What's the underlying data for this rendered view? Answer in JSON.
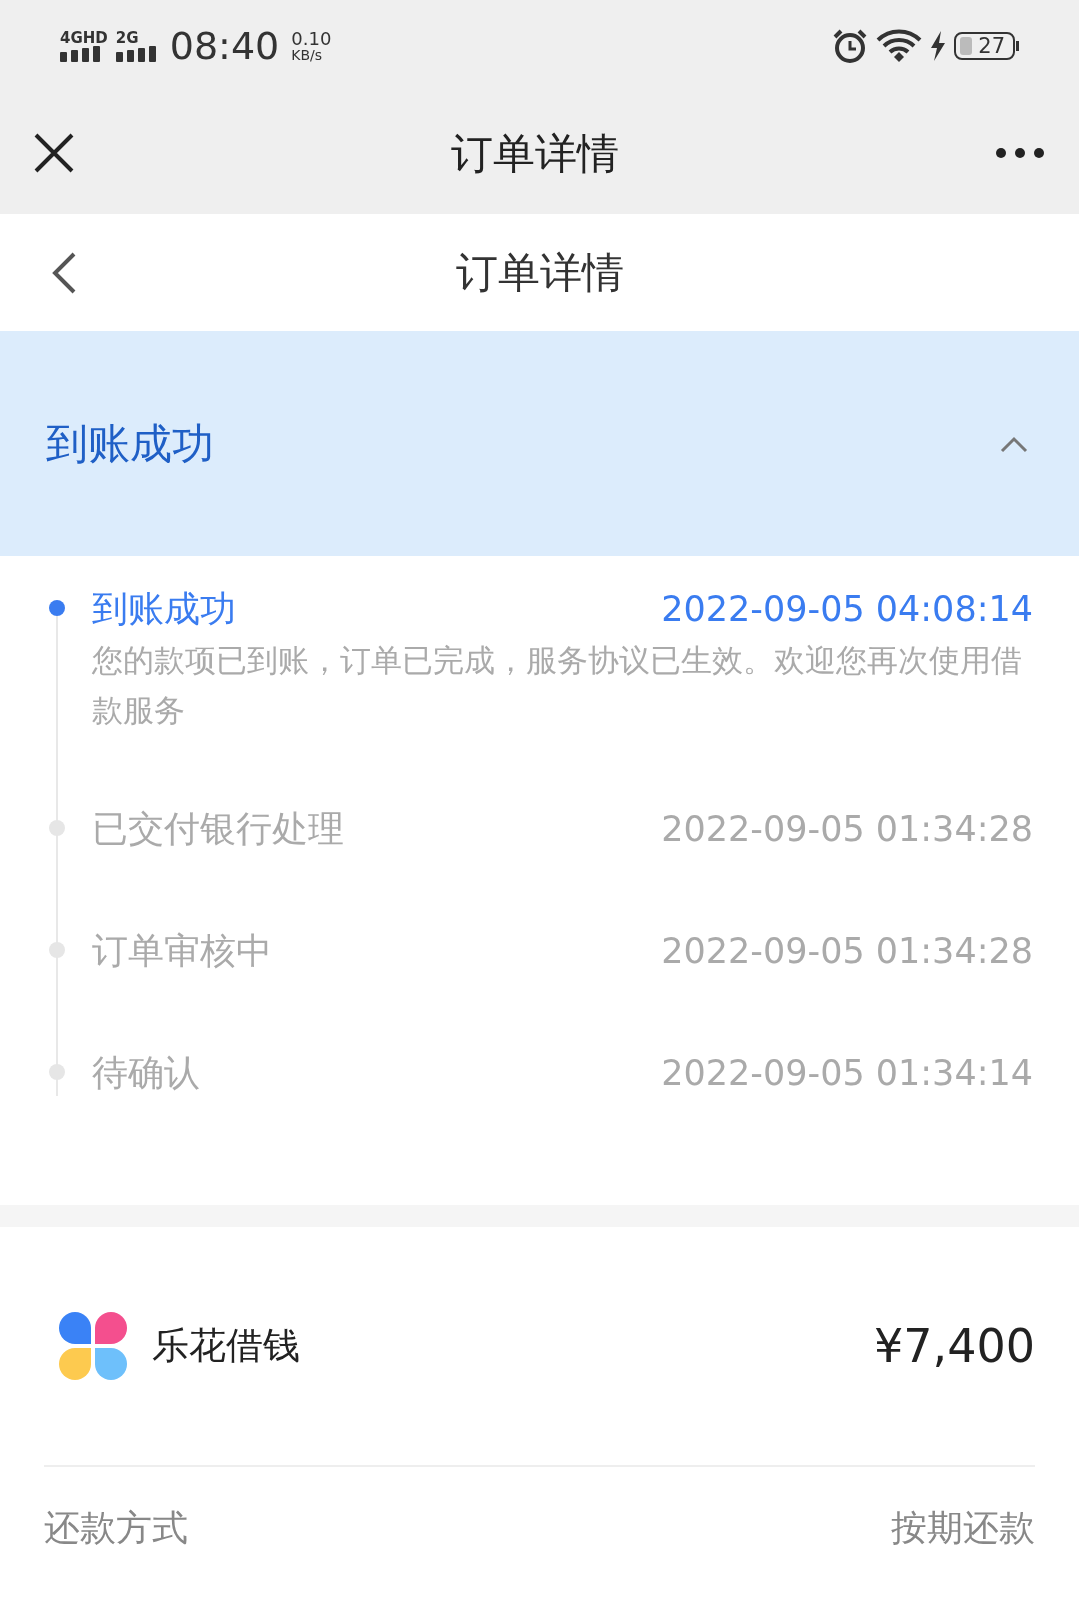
{
  "status_bar": {
    "network_1": "4GHD",
    "network_2": "2G",
    "time": "08:40",
    "speed_value": "0.10",
    "speed_unit": "KB/s",
    "battery": "27"
  },
  "title_bar": {
    "title": "订单详情"
  },
  "header": {
    "title": "订单详情"
  },
  "status_banner": {
    "title": "到账成功",
    "expanded": true
  },
  "timeline": [
    {
      "title": "到账成功",
      "time": "2022-09-05 04:08:14",
      "current": true,
      "description": "您的款项已到账，订单已完成，服务协议已生效。欢迎您再次使用借款服务"
    },
    {
      "title": "已交付银行处理",
      "time": "2022-09-05 01:34:28",
      "current": false
    },
    {
      "title": "订单审核中",
      "time": "2022-09-05 01:34:28",
      "current": false
    },
    {
      "title": "待确认",
      "time": "2022-09-05 01:34:14",
      "current": false
    }
  ],
  "product": {
    "name": "乐花借钱",
    "amount": "¥7,400"
  },
  "details": [
    {
      "label": "还款方式",
      "value": "按期还款"
    }
  ]
}
